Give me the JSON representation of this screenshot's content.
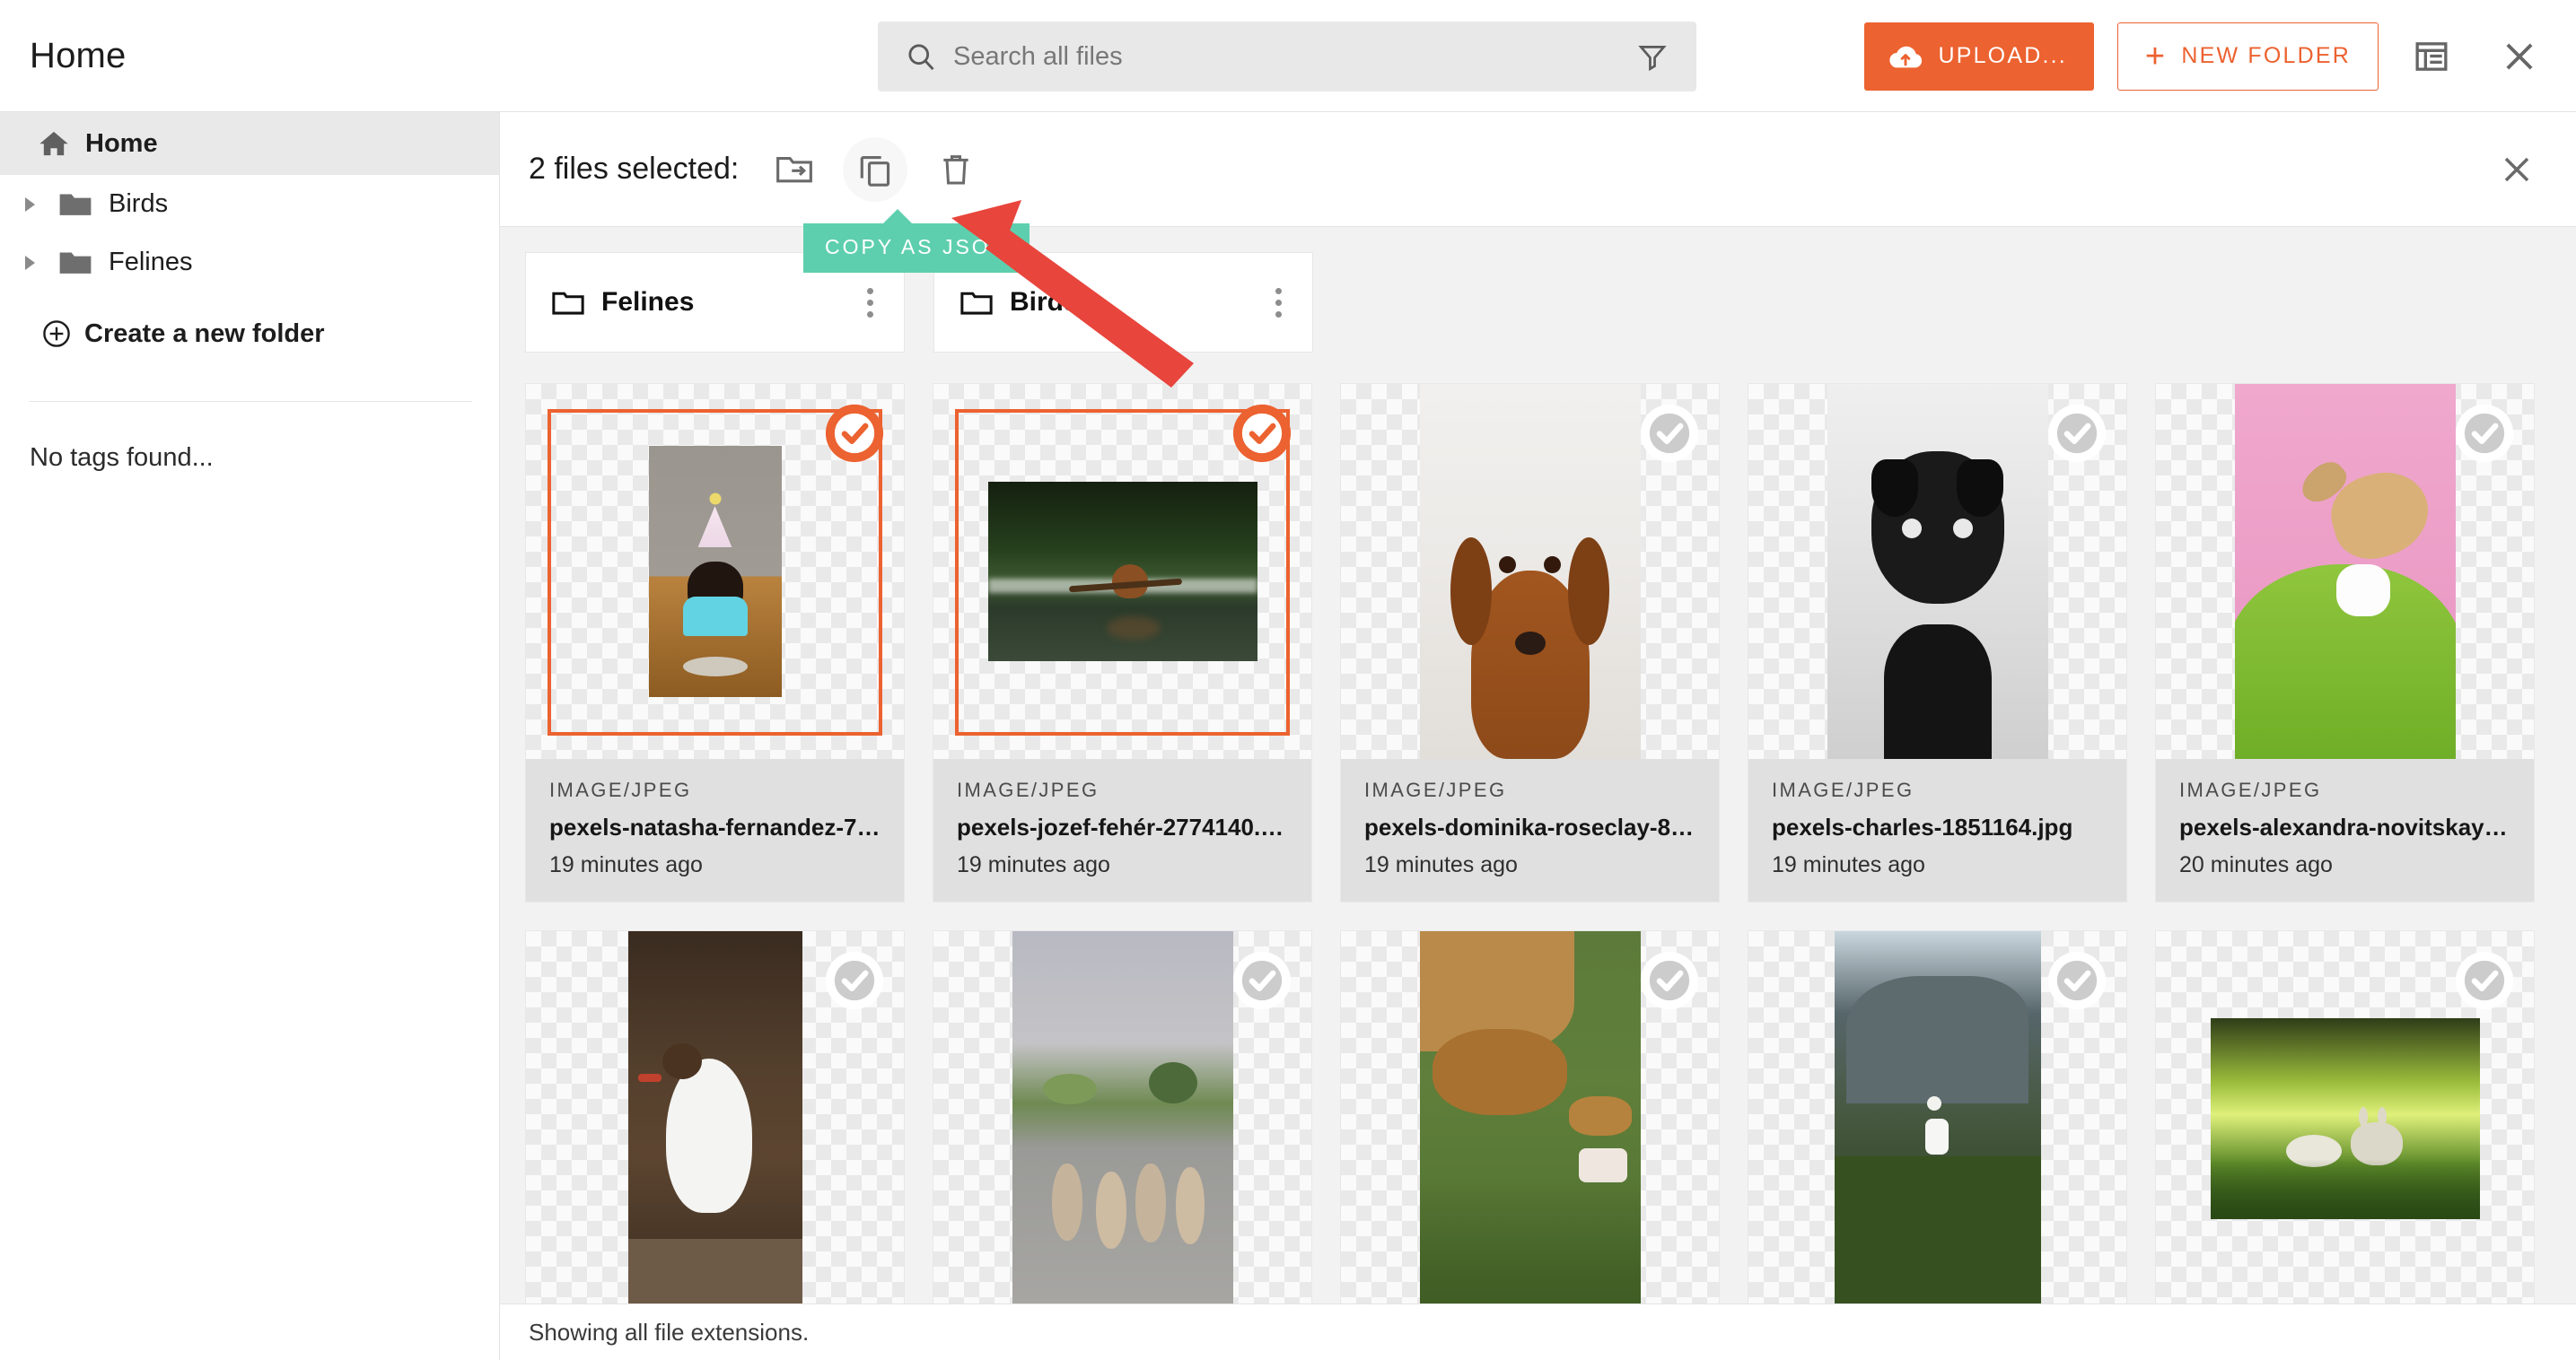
{
  "header": {
    "title": "Home",
    "search": {
      "placeholder": "Search all files",
      "value": ""
    },
    "upload_label": "UPLOAD...",
    "new_folder_label": "NEW FOLDER",
    "list_view_title": "List view",
    "close_title": "Close"
  },
  "sidebar": {
    "home_label": "Home",
    "folders": [
      {
        "label": "Birds"
      },
      {
        "label": "Felines"
      }
    ],
    "create_folder_label": "Create a new folder",
    "tags_empty": "No tags found..."
  },
  "selection_bar": {
    "label": "2 files selected:",
    "actions": [
      {
        "name": "move-to-folder",
        "title": "Move to folder"
      },
      {
        "name": "copy-as-json",
        "title": "Copy as JSON"
      },
      {
        "name": "delete",
        "title": "Delete"
      }
    ],
    "tooltip": "COPY AS JSON",
    "close_title": "Clear selection"
  },
  "folders": [
    {
      "name": "Felines"
    },
    {
      "name": "Birds"
    }
  ],
  "files": [
    {
      "mime": "IMAGE/JPEG",
      "name": "pexels-natasha-fernandez-733...",
      "time": "19 minutes ago",
      "selected": true,
      "orientation": "portrait",
      "alt": "dachshund puppy wearing a party hat in front of a cake"
    },
    {
      "mime": "IMAGE/JPEG",
      "name": "pexels-jozef-fehér-2774140.jpg",
      "time": "19 minutes ago",
      "selected": true,
      "orientation": "landscape",
      "alt": "brown dog swimming in a lake carrying a stick"
    },
    {
      "mime": "IMAGE/JPEG",
      "name": "pexels-dominika-roseclay-8952...",
      "time": "19 minutes ago",
      "selected": false,
      "orientation": "tall",
      "alt": "brown dachshund portrait on white background"
    },
    {
      "mime": "IMAGE/JPEG",
      "name": "pexels-charles-1851164.jpg",
      "time": "19 minutes ago",
      "selected": false,
      "orientation": "tall",
      "alt": "black pug portrait in black and white"
    },
    {
      "mime": "IMAGE/JPEG",
      "name": "pexels-alexandra-novitskaya-2...",
      "time": "20 minutes ago",
      "selected": false,
      "orientation": "tall",
      "alt": "dog in green fur coat on pink background"
    },
    {
      "mime": "",
      "name": "",
      "time": "",
      "selected": false,
      "orientation": "tall",
      "alt": "white seagull perched on a rail"
    },
    {
      "mime": "",
      "name": "",
      "time": "",
      "selected": false,
      "orientation": "tall",
      "alt": "flock of geese walking on a country road"
    },
    {
      "mime": "",
      "name": "",
      "time": "",
      "selected": false,
      "orientation": "tall",
      "alt": "deer lying in grass being fed by a child"
    },
    {
      "mime": "",
      "name": "",
      "time": "",
      "selected": false,
      "orientation": "tall",
      "alt": "white reindeer standing on a rocky green hillside"
    },
    {
      "mime": "",
      "name": "",
      "time": "",
      "selected": false,
      "orientation": "landscape",
      "alt": "two lambs resting in tall green grass"
    }
  ],
  "status": {
    "text": "Showing all file extensions."
  },
  "colors": {
    "accent": "#ec6230",
    "tooltip_bg": "#5ecfae",
    "annotation_arrow": "#e8453c",
    "meta_bg": "#e0e0e0",
    "sidebar_active_bg": "#e9e9e9"
  }
}
